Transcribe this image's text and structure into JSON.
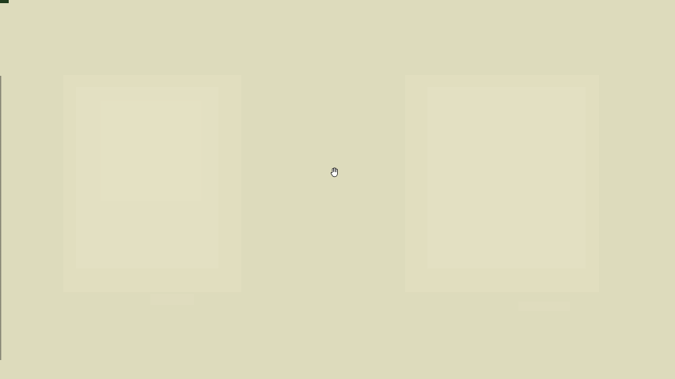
{
  "screen": {
    "background_color": "#dddbbc",
    "indicator_color": "#1f3b1d",
    "cursor_icon": "hand-cursor-icon"
  }
}
